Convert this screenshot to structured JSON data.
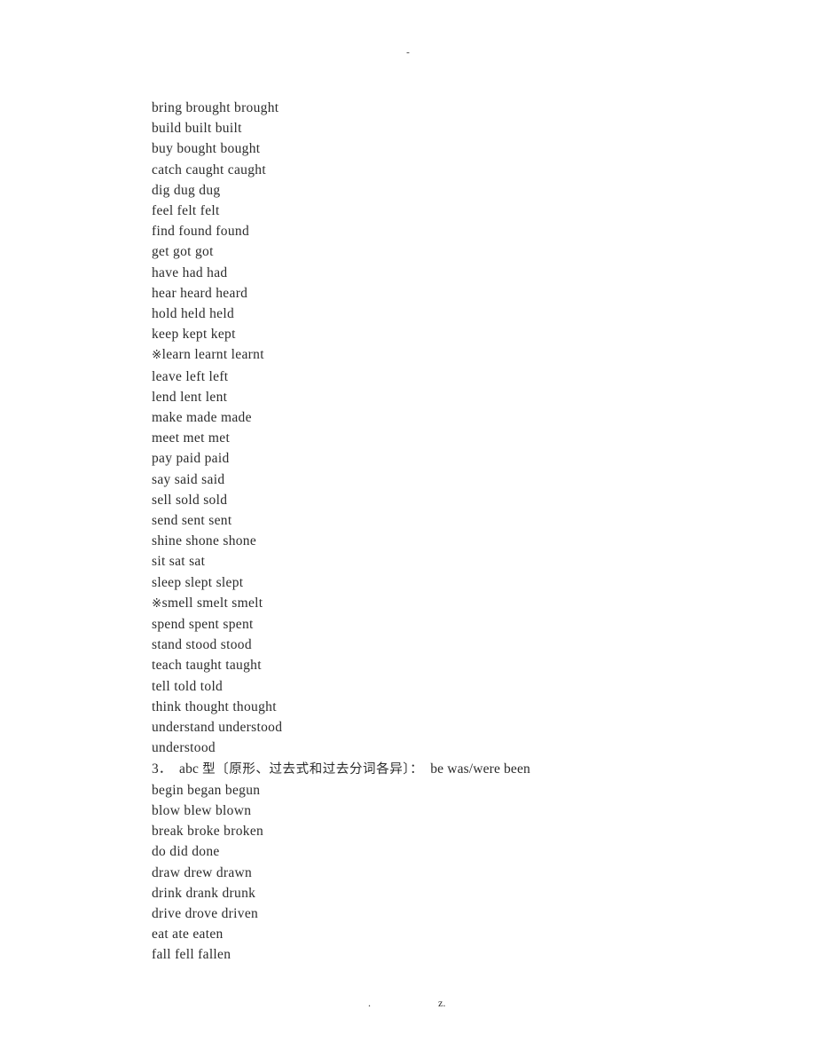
{
  "header": {
    "mark": "-"
  },
  "document": {
    "lines": [
      {
        "text": "bring brought brought",
        "type": "verb"
      },
      {
        "text": "build built built",
        "type": "verb"
      },
      {
        "text": "buy bought bought",
        "type": "verb"
      },
      {
        "text": "catch caught caught",
        "type": "verb"
      },
      {
        "text": "dig dug dug",
        "type": "verb"
      },
      {
        "text": "feel felt felt",
        "type": "verb"
      },
      {
        "text": "find found found",
        "type": "verb"
      },
      {
        "text": "get got got",
        "type": "verb"
      },
      {
        "text": "have had had",
        "type": "verb"
      },
      {
        "text": "hear heard heard",
        "type": "verb"
      },
      {
        "text": "hold held held",
        "type": "verb"
      },
      {
        "text": "keep kept kept",
        "type": "verb"
      },
      {
        "text": "※learn learnt learnt",
        "type": "verb-marked"
      },
      {
        "text": "leave left left",
        "type": "verb"
      },
      {
        "text": "lend lent lent",
        "type": "verb"
      },
      {
        "text": "make made made",
        "type": "verb"
      },
      {
        "text": "meet met met",
        "type": "verb"
      },
      {
        "text": "pay paid paid",
        "type": "verb"
      },
      {
        "text": "say said said",
        "type": "verb"
      },
      {
        "text": "sell sold sold",
        "type": "verb"
      },
      {
        "text": "send sent sent",
        "type": "verb"
      },
      {
        "text": "shine shone shone",
        "type": "verb"
      },
      {
        "text": "sit sat sat",
        "type": "verb"
      },
      {
        "text": "sleep slept slept",
        "type": "verb"
      },
      {
        "text": "※smell smelt smelt",
        "type": "verb-marked"
      },
      {
        "text": "spend spent spent",
        "type": "verb"
      },
      {
        "text": "stand stood stood",
        "type": "verb"
      },
      {
        "text": "teach taught taught",
        "type": "verb"
      },
      {
        "text": "tell told told",
        "type": "verb"
      },
      {
        "text": "think thought thought",
        "type": "verb"
      },
      {
        "text": "understand understood",
        "type": "verb"
      },
      {
        "text": "understood",
        "type": "verb"
      },
      {
        "text": "3．  abc 型〔原形、过去式和过去分词各异〕：  be was/were been",
        "type": "heading"
      },
      {
        "text": "begin began begun",
        "type": "verb"
      },
      {
        "text": "blow blew blown",
        "type": "verb"
      },
      {
        "text": "break broke broken",
        "type": "verb"
      },
      {
        "text": "do did done",
        "type": "verb"
      },
      {
        "text": "draw drew drawn",
        "type": "verb"
      },
      {
        "text": "drink drank drunk",
        "type": "verb"
      },
      {
        "text": "drive drove driven",
        "type": "verb"
      },
      {
        "text": "eat ate eaten",
        "type": "verb"
      },
      {
        "text": "fall fell fallen",
        "type": "verb"
      }
    ]
  },
  "footer": {
    "dot": ".",
    "z": "z."
  }
}
